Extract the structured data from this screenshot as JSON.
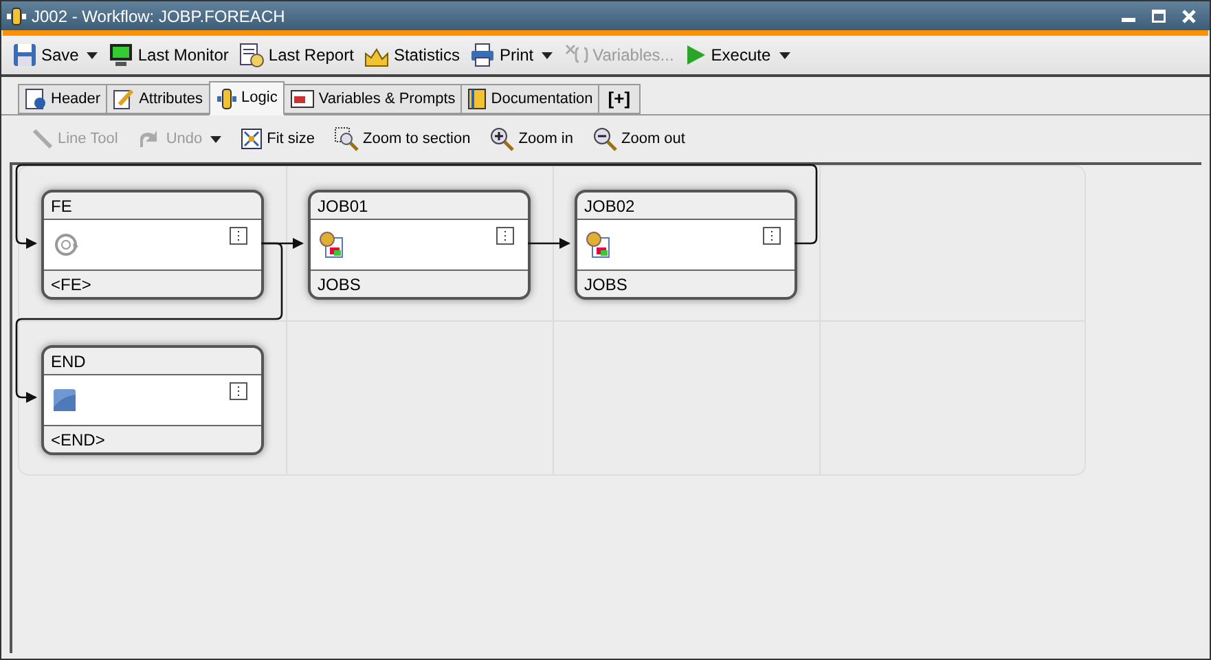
{
  "window": {
    "title": "J002 - Workflow: JOBP.FOREACH"
  },
  "toolbar": [
    {
      "label": "Save",
      "dropdown": true,
      "disabled": false
    },
    {
      "label": "Last Monitor",
      "dropdown": false,
      "disabled": false
    },
    {
      "label": "Last Report",
      "dropdown": false,
      "disabled": false
    },
    {
      "label": "Statistics",
      "dropdown": false,
      "disabled": false
    },
    {
      "label": "Print",
      "dropdown": true,
      "disabled": false
    },
    {
      "label": "Variables...",
      "dropdown": false,
      "disabled": true
    },
    {
      "label": "Execute",
      "dropdown": true,
      "disabled": false
    }
  ],
  "tabs": [
    {
      "label": "Header",
      "selected": false
    },
    {
      "label": "Attributes",
      "selected": false
    },
    {
      "label": "Logic",
      "selected": true
    },
    {
      "label": "Variables & Prompts",
      "selected": false
    },
    {
      "label": "Documentation",
      "selected": false
    },
    {
      "label": "[+]",
      "selected": false
    }
  ],
  "canvas_tools": [
    {
      "label": "Line Tool",
      "dropdown": false,
      "disabled": true
    },
    {
      "label": "Undo",
      "dropdown": true,
      "disabled": true
    },
    {
      "label": "Fit size",
      "dropdown": false,
      "disabled": false
    },
    {
      "label": "Zoom to section",
      "dropdown": false,
      "disabled": false
    },
    {
      "label": "Zoom in",
      "dropdown": false,
      "disabled": false
    },
    {
      "label": "Zoom out",
      "dropdown": false,
      "disabled": false
    }
  ],
  "nodes": [
    {
      "title": "FE",
      "footer": "<FE>",
      "kind": "loop"
    },
    {
      "title": "JOB01",
      "footer": "JOBS",
      "kind": "job"
    },
    {
      "title": "JOB02",
      "footer": "JOBS",
      "kind": "job"
    },
    {
      "title": "END",
      "footer": "<END>",
      "kind": "end"
    }
  ]
}
